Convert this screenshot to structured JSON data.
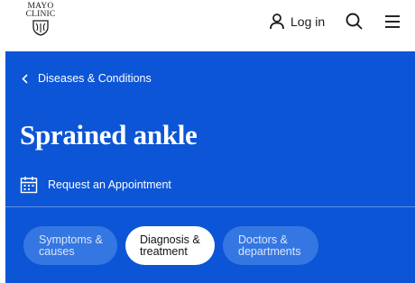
{
  "header": {
    "logo": {
      "line1": "MAYO",
      "line2": "CLINIC",
      "icon": "mayo-shield-logo"
    },
    "login_label": "Log in",
    "login_icon": "user-icon",
    "search_icon": "search-icon",
    "menu_icon": "hamburger-menu-icon"
  },
  "hero": {
    "breadcrumb": {
      "label": "Diseases & Conditions",
      "icon": "chevron-left-icon"
    },
    "title": "Sprained ankle",
    "appointment": {
      "label": "Request an Appointment",
      "icon": "calendar-icon"
    },
    "tabs": [
      {
        "line1": "Symptoms &",
        "line2": "causes",
        "selected": false
      },
      {
        "line1": "Diagnosis &",
        "line2": "treatment",
        "selected": true
      },
      {
        "line1": "Doctors &",
        "line2": "departments",
        "selected": false
      }
    ]
  },
  "colors": {
    "brand_blue": "#0c55d6",
    "tab_inactive": "#3577e2",
    "text_dark": "#1b1b1b"
  }
}
